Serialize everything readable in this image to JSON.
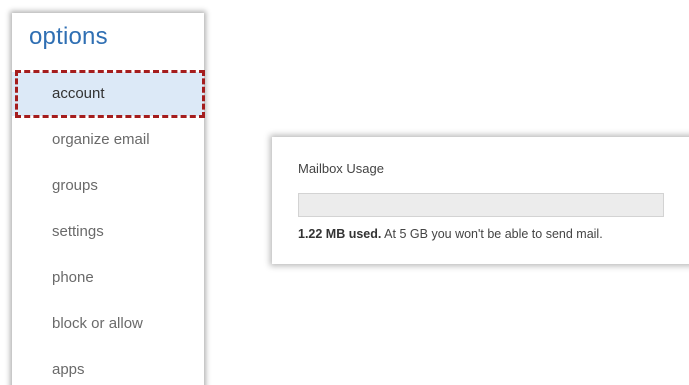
{
  "options": {
    "title": "options",
    "items": [
      {
        "label": "account",
        "selected": true
      },
      {
        "label": "organize email",
        "selected": false
      },
      {
        "label": "groups",
        "selected": false
      },
      {
        "label": "settings",
        "selected": false
      },
      {
        "label": "phone",
        "selected": false
      },
      {
        "label": "block or allow",
        "selected": false
      },
      {
        "label": "apps",
        "selected": false
      }
    ]
  },
  "mailbox": {
    "title": "Mailbox Usage",
    "used_text": "1.22 MB used.",
    "limit_prefix": "At",
    "limit_value": "5",
    "limit_suffix": "GB you won't be able to send mail.",
    "usage_fraction": 0.0
  },
  "colors": {
    "accent": "#2f6fb3",
    "selected_bg": "#dce9f7",
    "highlight": "#a51d1d"
  }
}
